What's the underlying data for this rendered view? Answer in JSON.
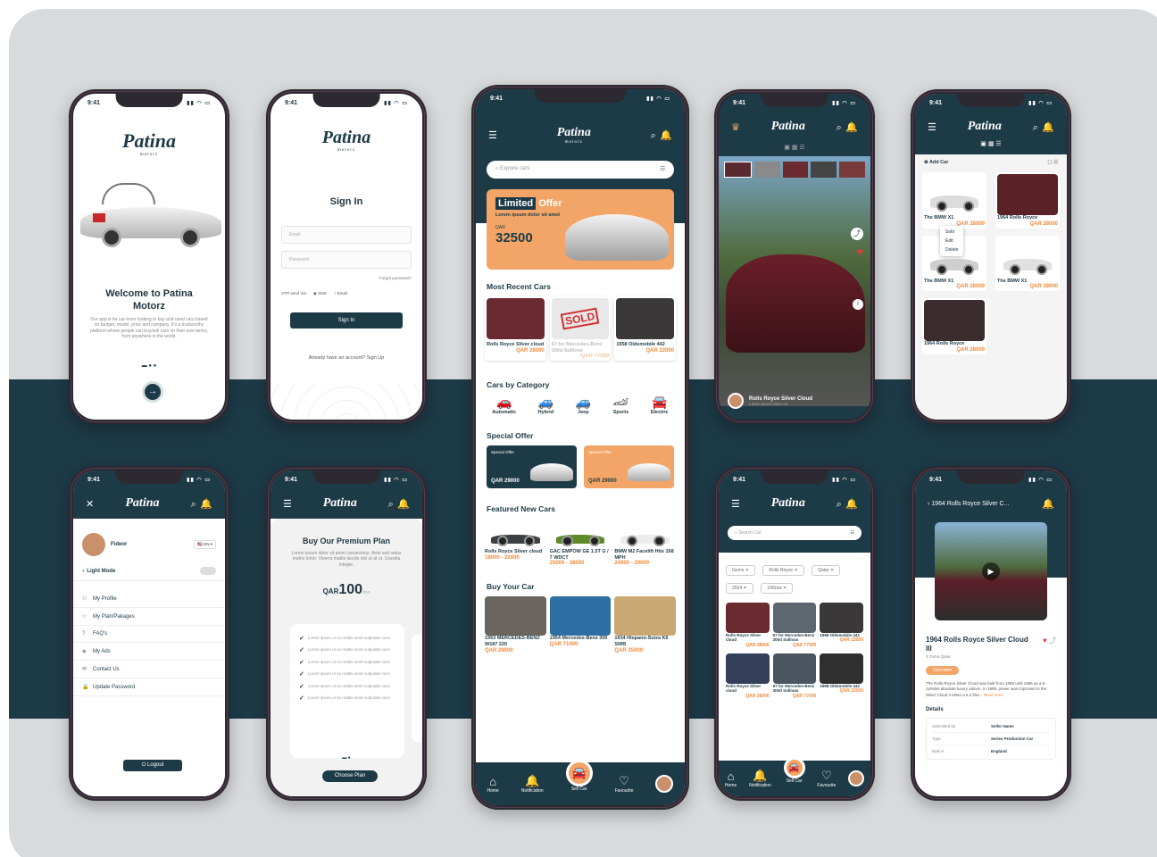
{
  "status_time": "9:41",
  "brand": {
    "logo": "Patina",
    "tag": "motorz"
  },
  "welcome": {
    "title": "Welcome to Patina Motorz",
    "body": "Our app is for car-lover looking to buy and used cars based on budget, model, price and company. It's a trustworthy platform where people can buy/sell cars on their own terms, from anywhere in the world."
  },
  "signin": {
    "title": "Sign In",
    "email": "Email",
    "password": "Password",
    "forgot": "Forgot password?",
    "otp": "OTP send Via",
    "sms": "SMS",
    "email_opt": "Email",
    "button": "Sign In",
    "signup": "Already have an account? Sign Up"
  },
  "home": {
    "search": "Explore cars",
    "offer_title": "Limited",
    "offer_word": "Offer",
    "offer_desc": "Lorem ipsum dolor sit amet",
    "offer_currency": "QAR",
    "offer_price": "32500",
    "recent_title": "Most Recent Cars",
    "recent": [
      {
        "name": "Rolls Royce Silver cloud",
        "price": "QAR 28000"
      },
      {
        "name": "67 for Mercedes-Benz 300d Sullivan",
        "price": "QAR 77000",
        "sold": "SOLD"
      },
      {
        "name": "1958 Oldsmobile 442",
        "price": "QAR 22000"
      }
    ],
    "category_title": "Cars by Category",
    "categories": [
      "Automatic",
      "Hybrid",
      "Jeep",
      "Sports",
      "Electric"
    ],
    "special_title": "Special Offer",
    "special": [
      {
        "tag": "Special Offer",
        "price": "QAR 29000"
      },
      {
        "tag": "Special Offer",
        "price": "QAR 29000"
      }
    ],
    "featured_title": "Featured New Cars",
    "featured": [
      {
        "name": "Rolls Royce Silver cloud",
        "price": "18000 - 22000"
      },
      {
        "name": "GAC EMPOW GE 1.5T G / 7 WDCT",
        "price": "25000 - 28000"
      },
      {
        "name": "BMW M2 Facelift Hits 168 MPH",
        "price": "24000 - 29000"
      }
    ],
    "buy_title": "Buy Your Car",
    "buy": [
      {
        "name": "1953 MERCEDES-BENZ W187 220",
        "price": "QAR 28000"
      },
      {
        "name": "1954 Mercedes-Benz 300",
        "price": "QAR 71000"
      },
      {
        "name": "1934 Hispano-Suiza K6 SWB",
        "price": "QAR 35000"
      }
    ],
    "nav": [
      "Home",
      "Notification",
      "Sell Car",
      "Favourite",
      ""
    ]
  },
  "gallery": {
    "caption": "Rolls Royce Silver Cloud",
    "sub": "Lorem ipsum dolor sit"
  },
  "mycars": {
    "add": "Add Car",
    "items": [
      {
        "name": "The BMW X1",
        "price": "QAR 28000"
      },
      {
        "name": "1964 Rolls Royce",
        "price": "QAR 28000"
      },
      {
        "name": "The BMW X1",
        "price": "QAR 28000"
      },
      {
        "name": "The BMW X1",
        "price": "QAR 28000"
      },
      {
        "name": "1964 Rolls Royce",
        "price": "QAR 28000"
      }
    ],
    "menu": [
      "Sold",
      "Edit",
      "Delete"
    ]
  },
  "profile": {
    "name": "Fideor",
    "light": "Light Mode",
    "lang": "EN",
    "menu": [
      "My Profile",
      "My Plan/Pakages",
      "FAQ's",
      "My Ads",
      "Contact Us",
      "Update Password"
    ],
    "logout": "Logout"
  },
  "premium": {
    "title": "Buy Our Premium Plan",
    "desc": "Lorem ipsum dolor sit amet consectetur. Ante sed netus mattis tortor. Viverra mattis iaculis nisl ut at ut. Gravida integer.",
    "currency": "QAR",
    "amount": "100",
    "per": "/mo",
    "feature": "Lorem ipsum ut eu mattis amet vulputate nunc",
    "button": "Choose Plan"
  },
  "search": {
    "placeholder": "Search Car",
    "filters": [
      "Gems",
      "Rolls Royce",
      "Qatar",
      "2024",
      "100Lbs"
    ],
    "results": [
      {
        "name": "Rolls Royce Silver cloud",
        "price": "QAR 28000"
      },
      {
        "name": "67 for Mercedes-Benz 300d Sullivan",
        "price": "QAR 77000"
      },
      {
        "name": "1958 Oldsmobile 442",
        "price": "QAR 22000"
      },
      {
        "name": "Rolls Royce Silver cloud",
        "price": "QAR 28000"
      },
      {
        "name": "67 for Mercedes-Benz 300d Sullivan",
        "price": "QAR 77000"
      },
      {
        "name": "1958 Oldsmobile 442",
        "price": "QAR 22000"
      }
    ]
  },
  "detail": {
    "header": "1964 Rolls Royce Silver C...",
    "title": "1964 Rolls Royce Silver Cloud III",
    "loc": "Doha Qatar",
    "tab": "Overview",
    "desc": "The Rolls-Royce Silver Cloud was built from 1955 until 1966 as a 6-cylinder absolute luxury saloon. In 1959, power was improved in the Silver Cloud II when a 6.2 litre...",
    "more": "Read more",
    "details": "Details",
    "rows": [
      [
        "Submitted by",
        "Seller Name"
      ],
      [
        "Type",
        "Series Production Car"
      ],
      [
        "Built in",
        "England"
      ]
    ]
  }
}
